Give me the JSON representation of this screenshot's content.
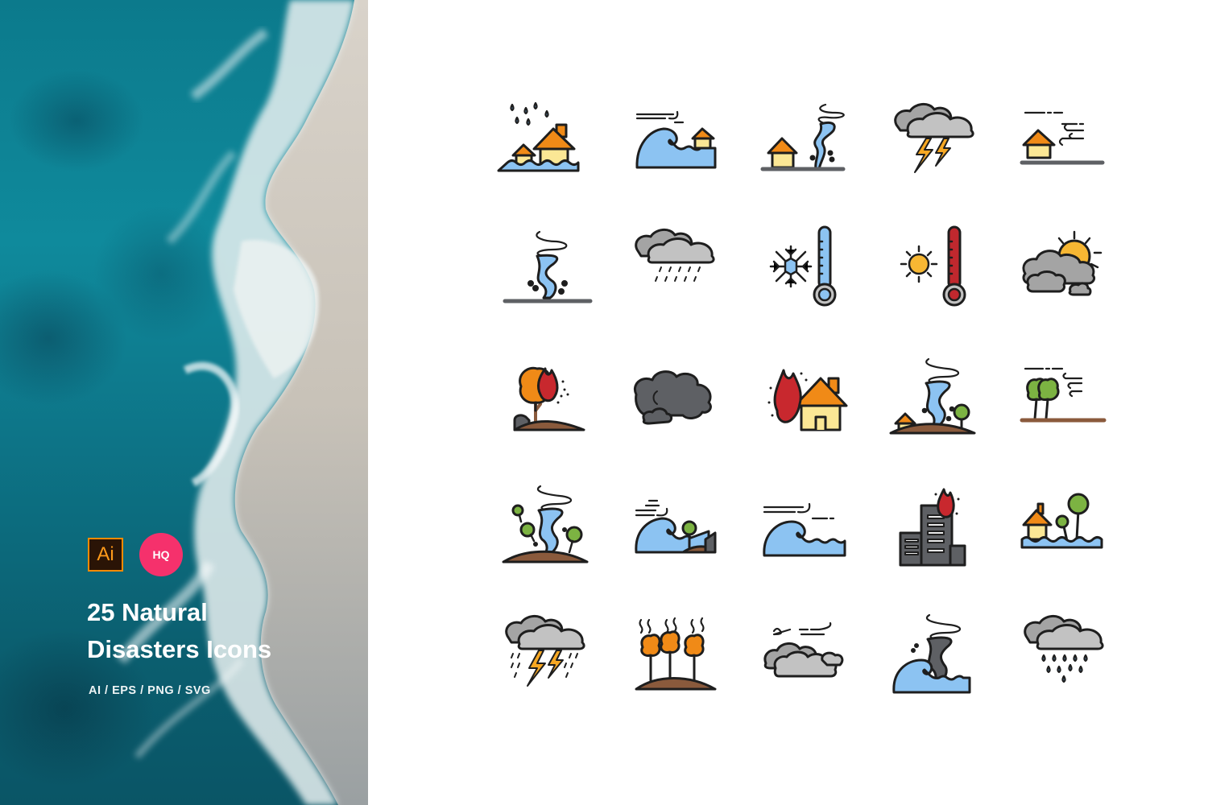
{
  "hero": {
    "title_line1": "25 Natural",
    "title_line2": "Disasters Icons",
    "formats": "AI / EPS / PNG / SVG",
    "ai_badge": "Ai",
    "hq_badge": "HQ",
    "colors": {
      "hq": "#f5316c",
      "ai_border": "#ff8a00",
      "ai_bg": "#2a1406"
    }
  },
  "icons": [
    {
      "name": "flood-houses-rain"
    },
    {
      "name": "tsunami-house"
    },
    {
      "name": "tornado-house"
    },
    {
      "name": "thunderstorm-clouds"
    },
    {
      "name": "wind-house"
    },
    {
      "name": "tornado-debris"
    },
    {
      "name": "rain-clouds"
    },
    {
      "name": "cold-thermometer-snowflake"
    },
    {
      "name": "heat-thermometer-sun"
    },
    {
      "name": "sun-behind-clouds"
    },
    {
      "name": "forest-fire-tree"
    },
    {
      "name": "dark-smoke-clouds"
    },
    {
      "name": "house-fire"
    },
    {
      "name": "tornado-house-tree-hill"
    },
    {
      "name": "wind-trees"
    },
    {
      "name": "tornado-trees-hill"
    },
    {
      "name": "tsunami-coast-tree"
    },
    {
      "name": "tsunami-wind"
    },
    {
      "name": "building-fire"
    },
    {
      "name": "flooded-house-trees"
    },
    {
      "name": "thunderstorm-rain-lightning"
    },
    {
      "name": "drought-heat-trees"
    },
    {
      "name": "windy-clouds"
    },
    {
      "name": "tsunami-tornado"
    },
    {
      "name": "heavy-rain-cloud"
    }
  ],
  "palette": {
    "outline": "#1e1e1e",
    "water": "#8cc3f2",
    "roof": "#f08a17",
    "wall": "#fbe795",
    "cloud": "#c2c2c2",
    "cloud_dark": "#5e6064",
    "flame": "#c8282e",
    "tree": "#7cb342",
    "orange_tree": "#f08a17",
    "soil": "#8a5a3c",
    "sun": "#f7b733",
    "thermo_hot": "#c0282e",
    "ground": "#5e6064"
  }
}
